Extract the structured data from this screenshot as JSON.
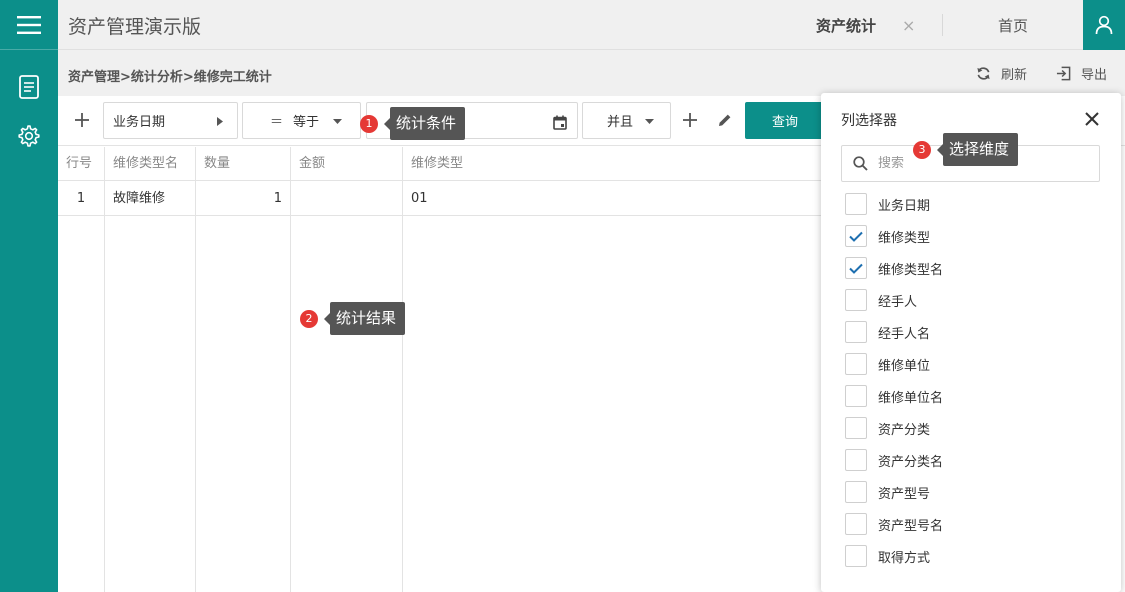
{
  "app": {
    "title": "资产管理演示版"
  },
  "tabs": {
    "active_label": "资产统计",
    "close_glyph": "×",
    "home_label": "首页"
  },
  "breadcrumb": "资产管理>统计分析>维修完工统计",
  "actions": {
    "refresh_label": "刷新",
    "export_label": "导出"
  },
  "conditions": {
    "field_value": "业务日期",
    "operator_glyph": "＝",
    "operator_value": "等于",
    "logic_value": "并且",
    "query_label": "查询"
  },
  "table": {
    "columns": [
      "行号",
      "维修类型名",
      "数量",
      "金额",
      "维修类型"
    ],
    "rows": [
      {
        "row_no": "1",
        "type_name": "故障维修",
        "qty": "1",
        "amount": "",
        "type": "01"
      }
    ]
  },
  "tooltips": [
    {
      "num": "1",
      "text": "统计条件"
    },
    {
      "num": "2",
      "text": "统计结果"
    },
    {
      "num": "3",
      "text": "选择维度"
    }
  ],
  "picker": {
    "title": "列选择器",
    "search_placeholder": "搜索",
    "options": [
      {
        "label": "业务日期",
        "checked": false
      },
      {
        "label": "维修类型",
        "checked": true
      },
      {
        "label": "维修类型名",
        "checked": true
      },
      {
        "label": "经手人",
        "checked": false
      },
      {
        "label": "经手人名",
        "checked": false
      },
      {
        "label": "维修单位",
        "checked": false
      },
      {
        "label": "维修单位名",
        "checked": false
      },
      {
        "label": "资产分类",
        "checked": false
      },
      {
        "label": "资产分类名",
        "checked": false
      },
      {
        "label": "资产型号",
        "checked": false
      },
      {
        "label": "资产型号名",
        "checked": false
      },
      {
        "label": "取得方式",
        "checked": false
      }
    ]
  },
  "colors": {
    "accent": "#0c8f8a",
    "badge": "#e53935",
    "tooltip": "#555555",
    "check": "#1e6fb0"
  },
  "icons": [
    "hamburger-menu-icon",
    "document-icon",
    "settings-gear-icon",
    "user-icon",
    "refresh-icon",
    "export-icon",
    "plus-icon",
    "caret-right-icon",
    "caret-down-icon",
    "calendar-icon",
    "pencil-icon",
    "close-icon",
    "search-icon",
    "check-icon"
  ]
}
